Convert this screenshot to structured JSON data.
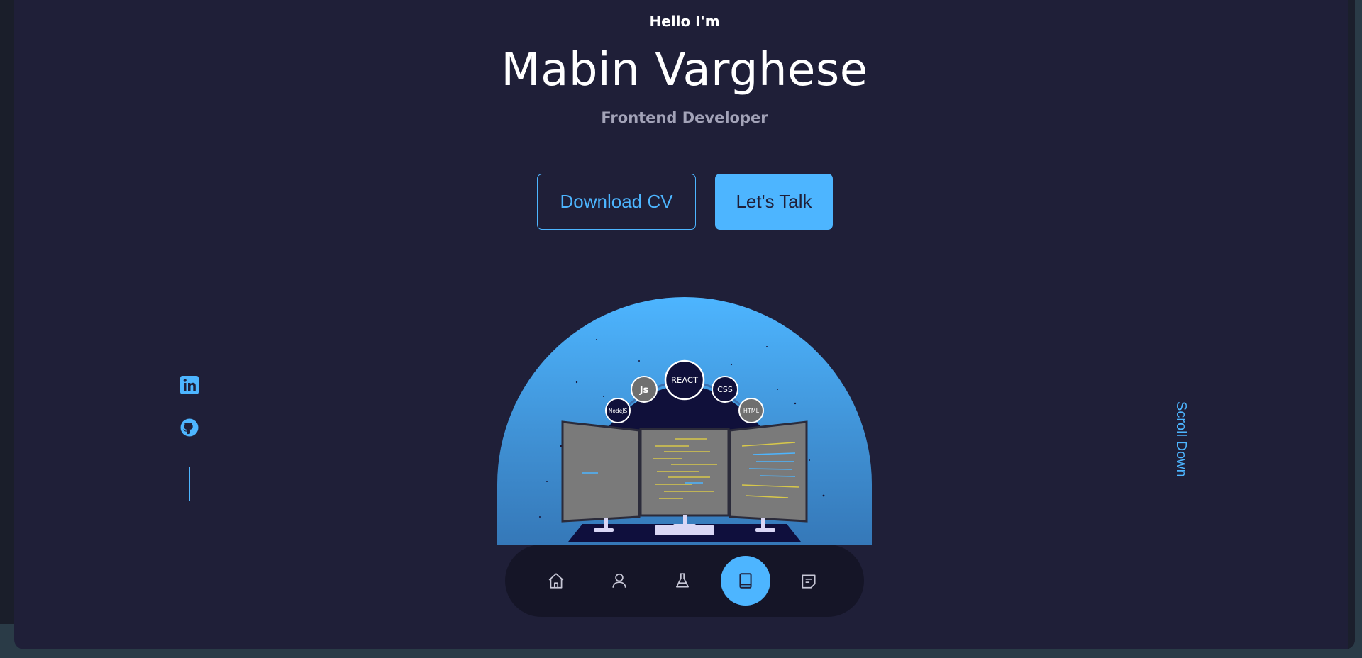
{
  "hero": {
    "greeting": "Hello I'm",
    "name": "Mabin Varghese",
    "role": "Frontend Developer"
  },
  "buttons": {
    "download_cv": "Download CV",
    "lets_talk": "Let's Talk"
  },
  "illustration": {
    "skill_bubbles": [
      "NodeJS",
      "Js",
      "REACT",
      "CSS",
      "HTML"
    ]
  },
  "socials": [
    {
      "icon": "linkedin-icon"
    },
    {
      "icon": "github-icon"
    }
  ],
  "scroll": {
    "label": "Scroll Down"
  },
  "nav": {
    "items": [
      {
        "icon": "home-icon",
        "active": false
      },
      {
        "icon": "user-icon",
        "active": false
      },
      {
        "icon": "flask-icon",
        "active": false
      },
      {
        "icon": "book-icon",
        "active": true
      },
      {
        "icon": "message-icon",
        "active": false
      }
    ]
  },
  "colors": {
    "background": "#1f1f38",
    "accent": "#4db5ff",
    "text": "#ffffff",
    "muted": "#a3a3b8",
    "nav_bg": "#141424"
  }
}
